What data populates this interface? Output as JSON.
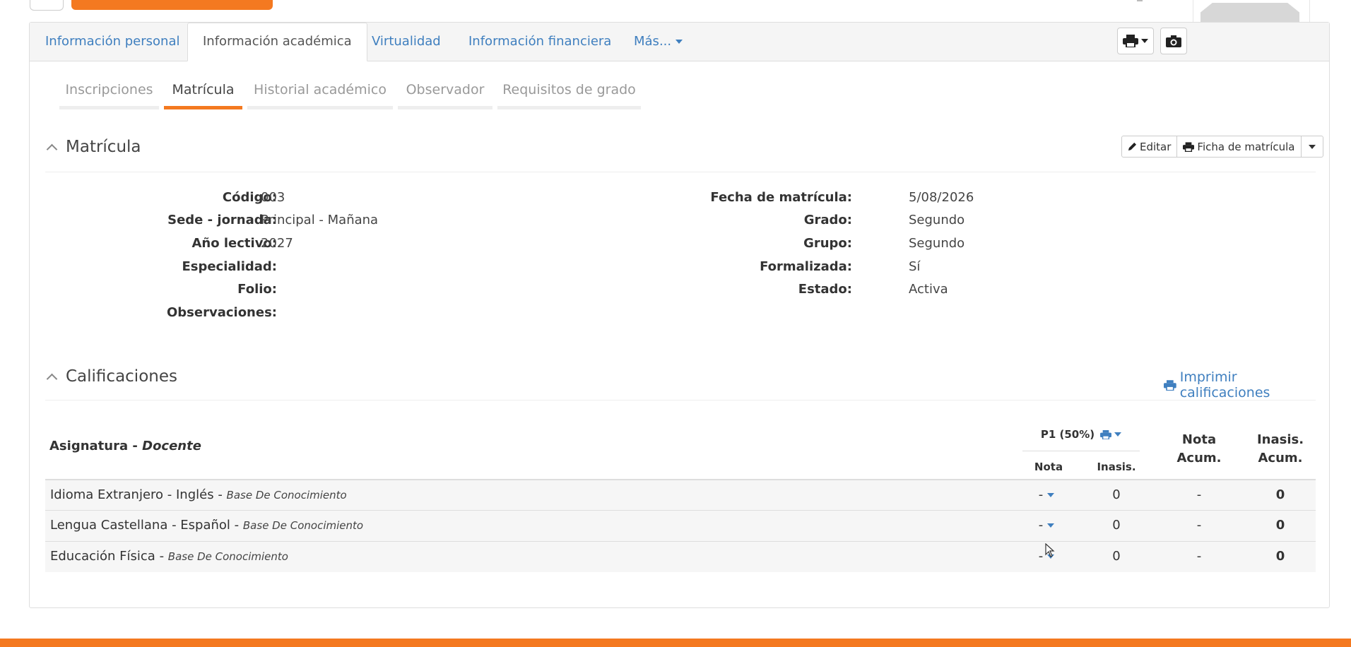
{
  "tabs": [
    {
      "label": "Información personal"
    },
    {
      "label": "Información académica"
    },
    {
      "label": "Virtualidad"
    },
    {
      "label": "Información financiera"
    },
    {
      "label": "Más..."
    }
  ],
  "subtabs": [
    {
      "label": "Inscripciones"
    },
    {
      "label": "Matrícula"
    },
    {
      "label": "Historial académico"
    },
    {
      "label": "Observador"
    },
    {
      "label": "Requisitos de grado"
    }
  ],
  "matricula": {
    "title": "Matrícula",
    "edit_label": "Editar",
    "ficha_label": "Ficha de matrícula",
    "left": [
      {
        "label": "Código:",
        "value": "003"
      },
      {
        "label": "Sede - jornada:",
        "value": "Principal - Mañana"
      },
      {
        "label": "Año lectivo:",
        "value": "2027"
      },
      {
        "label": "Especialidad:",
        "value": ""
      },
      {
        "label": "Folio:",
        "value": ""
      },
      {
        "label": "Observaciones:",
        "value": ""
      }
    ],
    "right": [
      {
        "label": "Fecha de matrícula:",
        "value": "5/08/2026"
      },
      {
        "label": "Grado:",
        "value": "Segundo"
      },
      {
        "label": "Grupo:",
        "value": "Segundo"
      },
      {
        "label": "Formalizada:",
        "value": "Sí"
      },
      {
        "label": "Estado:",
        "value": "Activa"
      }
    ]
  },
  "calificaciones": {
    "title": "Calificaciones",
    "print_label": "Imprimir calificaciones",
    "header": {
      "asignatura": "Asignatura",
      "docente": "Docente",
      "period": "P1 (50%)",
      "nota": "Nota",
      "inasis": "Inasis.",
      "nota_acum_1": "Nota",
      "nota_acum_2": "Acum.",
      "inasis_acum_1": "Inasis.",
      "inasis_acum_2": "Acum."
    },
    "rows": [
      {
        "subject": "Idioma Extranjero - Inglés",
        "teacher": "Base De Conocimiento",
        "nota": "-",
        "inasis": "0",
        "nota_acum": "-",
        "inasis_acum": "0"
      },
      {
        "subject": "Lengua Castellana - Español",
        "teacher": "Base De Conocimiento",
        "nota": "-",
        "inasis": "0",
        "nota_acum": "-",
        "inasis_acum": "0"
      },
      {
        "subject": "Educación Física",
        "teacher": "Base De Conocimiento",
        "nota": "-",
        "inasis": "0",
        "nota_acum": "-",
        "inasis_acum": "0"
      }
    ]
  },
  "colors": {
    "accent": "#f47920",
    "link": "#3f7fbf"
  }
}
